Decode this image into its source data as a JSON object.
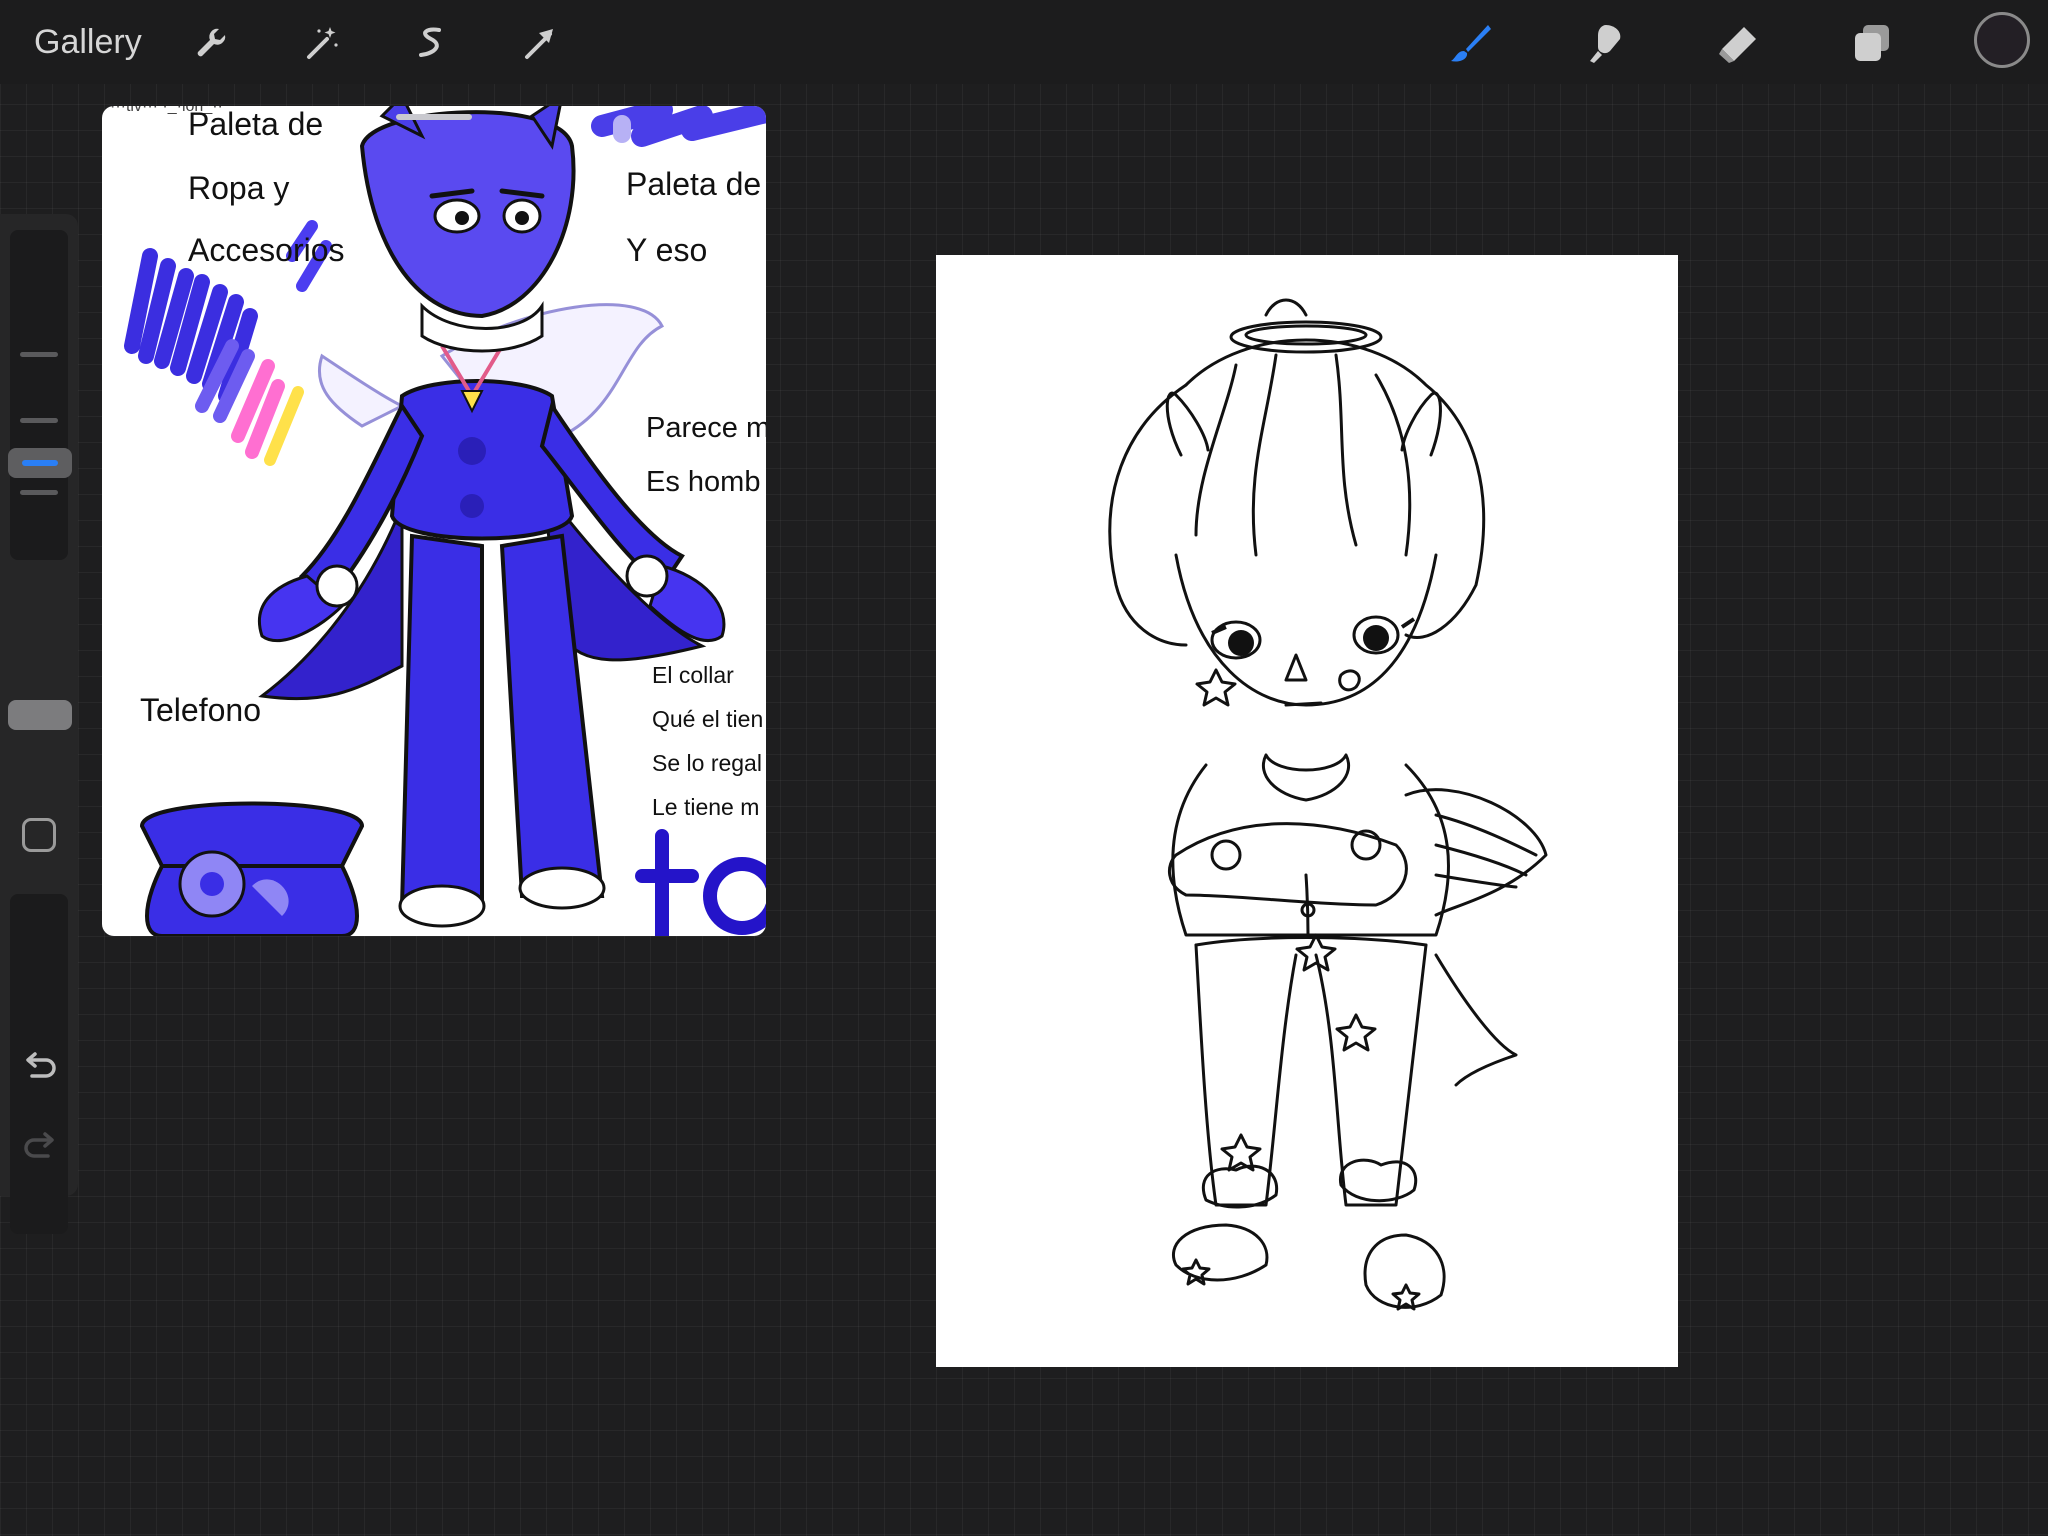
{
  "app": {
    "gallery_label": "Gallery"
  },
  "toolbar": {
    "left_tools": [
      {
        "icon": "wrench-icon",
        "name": "Actions"
      },
      {
        "icon": "magic-wand-icon",
        "name": "Adjustments"
      },
      {
        "icon": "selection-icon",
        "name": "Selection"
      },
      {
        "icon": "transform-arrow-icon",
        "name": "Transform"
      }
    ],
    "right_tools": [
      {
        "icon": "brush-icon",
        "name": "Brush",
        "active": true
      },
      {
        "icon": "smudge-icon",
        "name": "Smudge",
        "active": false
      },
      {
        "icon": "eraser-icon",
        "name": "Eraser",
        "active": false
      },
      {
        "icon": "layers-icon",
        "name": "Layers",
        "active": false
      }
    ],
    "current_color": "#231f25",
    "accent": "#2a7ff5"
  },
  "sidebar": {
    "brush_size_level": 0.35,
    "opacity_level": 0.02
  },
  "reference": {
    "header_cropped": "···tiv··· ·_·ion_··",
    "left_labels": [
      "Paleta de",
      "Ropa y",
      "Accesorios"
    ],
    "right_labels": [
      "Paleta de",
      "Y eso"
    ],
    "middle_labels": [
      "Parece m",
      "Es homb"
    ],
    "small_labels": [
      "El collar",
      "Qué el tien",
      "Se lo regal",
      "Le tiene m"
    ],
    "phone_label": "Telefono",
    "big_label": "to"
  }
}
